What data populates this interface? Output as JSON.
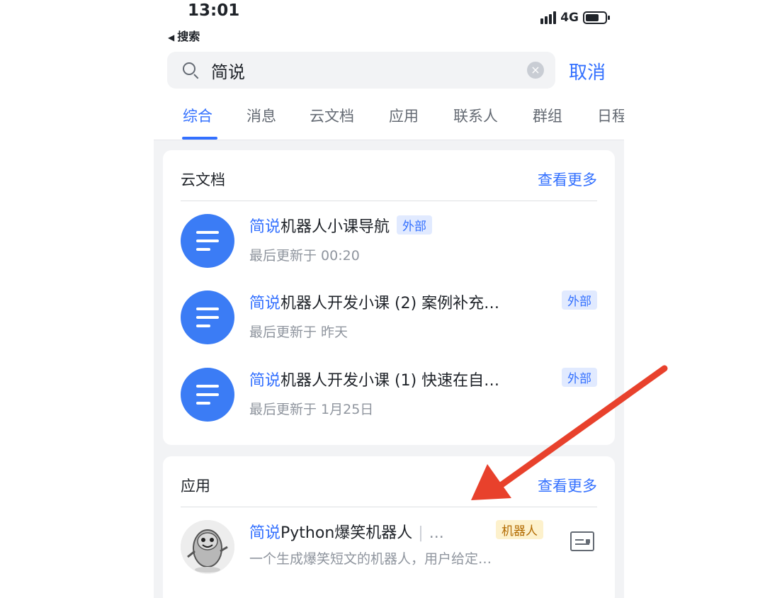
{
  "status_bar": {
    "time": "13:01",
    "back_label": "搜索",
    "network": "4G"
  },
  "search": {
    "value": "简说",
    "cancel_label": "取消"
  },
  "tabs": [
    {
      "label": "综合",
      "active": true
    },
    {
      "label": "消息"
    },
    {
      "label": "云文档"
    },
    {
      "label": "应用"
    },
    {
      "label": "联系人"
    },
    {
      "label": "群组"
    },
    {
      "label": "日程"
    }
  ],
  "docs_section": {
    "title": "云文档",
    "more_label": "查看更多",
    "items": [
      {
        "highlight": "简说",
        "title_rest": "机器人小课导航",
        "tag": "外部",
        "subtitle": "最后更新于 00:20"
      },
      {
        "highlight": "简说",
        "title_rest": "机器人开发小课 (2) 案例补充…",
        "tag": "外部",
        "subtitle": "最后更新于 昨天"
      },
      {
        "highlight": "简说",
        "title_rest": "机器人开发小课 (1) 快速在自…",
        "tag": "外部",
        "subtitle": "最后更新于 1月25日"
      }
    ]
  },
  "apps_section": {
    "title": "应用",
    "more_label": "查看更多",
    "items": [
      {
        "highlight": "简说",
        "title_rest": "Python爆笑机器人",
        "dots": "...",
        "tag": "机器人",
        "subtitle": "一个生成爆笑短文的机器人，用户给定…"
      }
    ]
  },
  "colors": {
    "accent": "#3370ff",
    "arrow": "#e8412c",
    "doc_icon": "#3b7cf5"
  }
}
